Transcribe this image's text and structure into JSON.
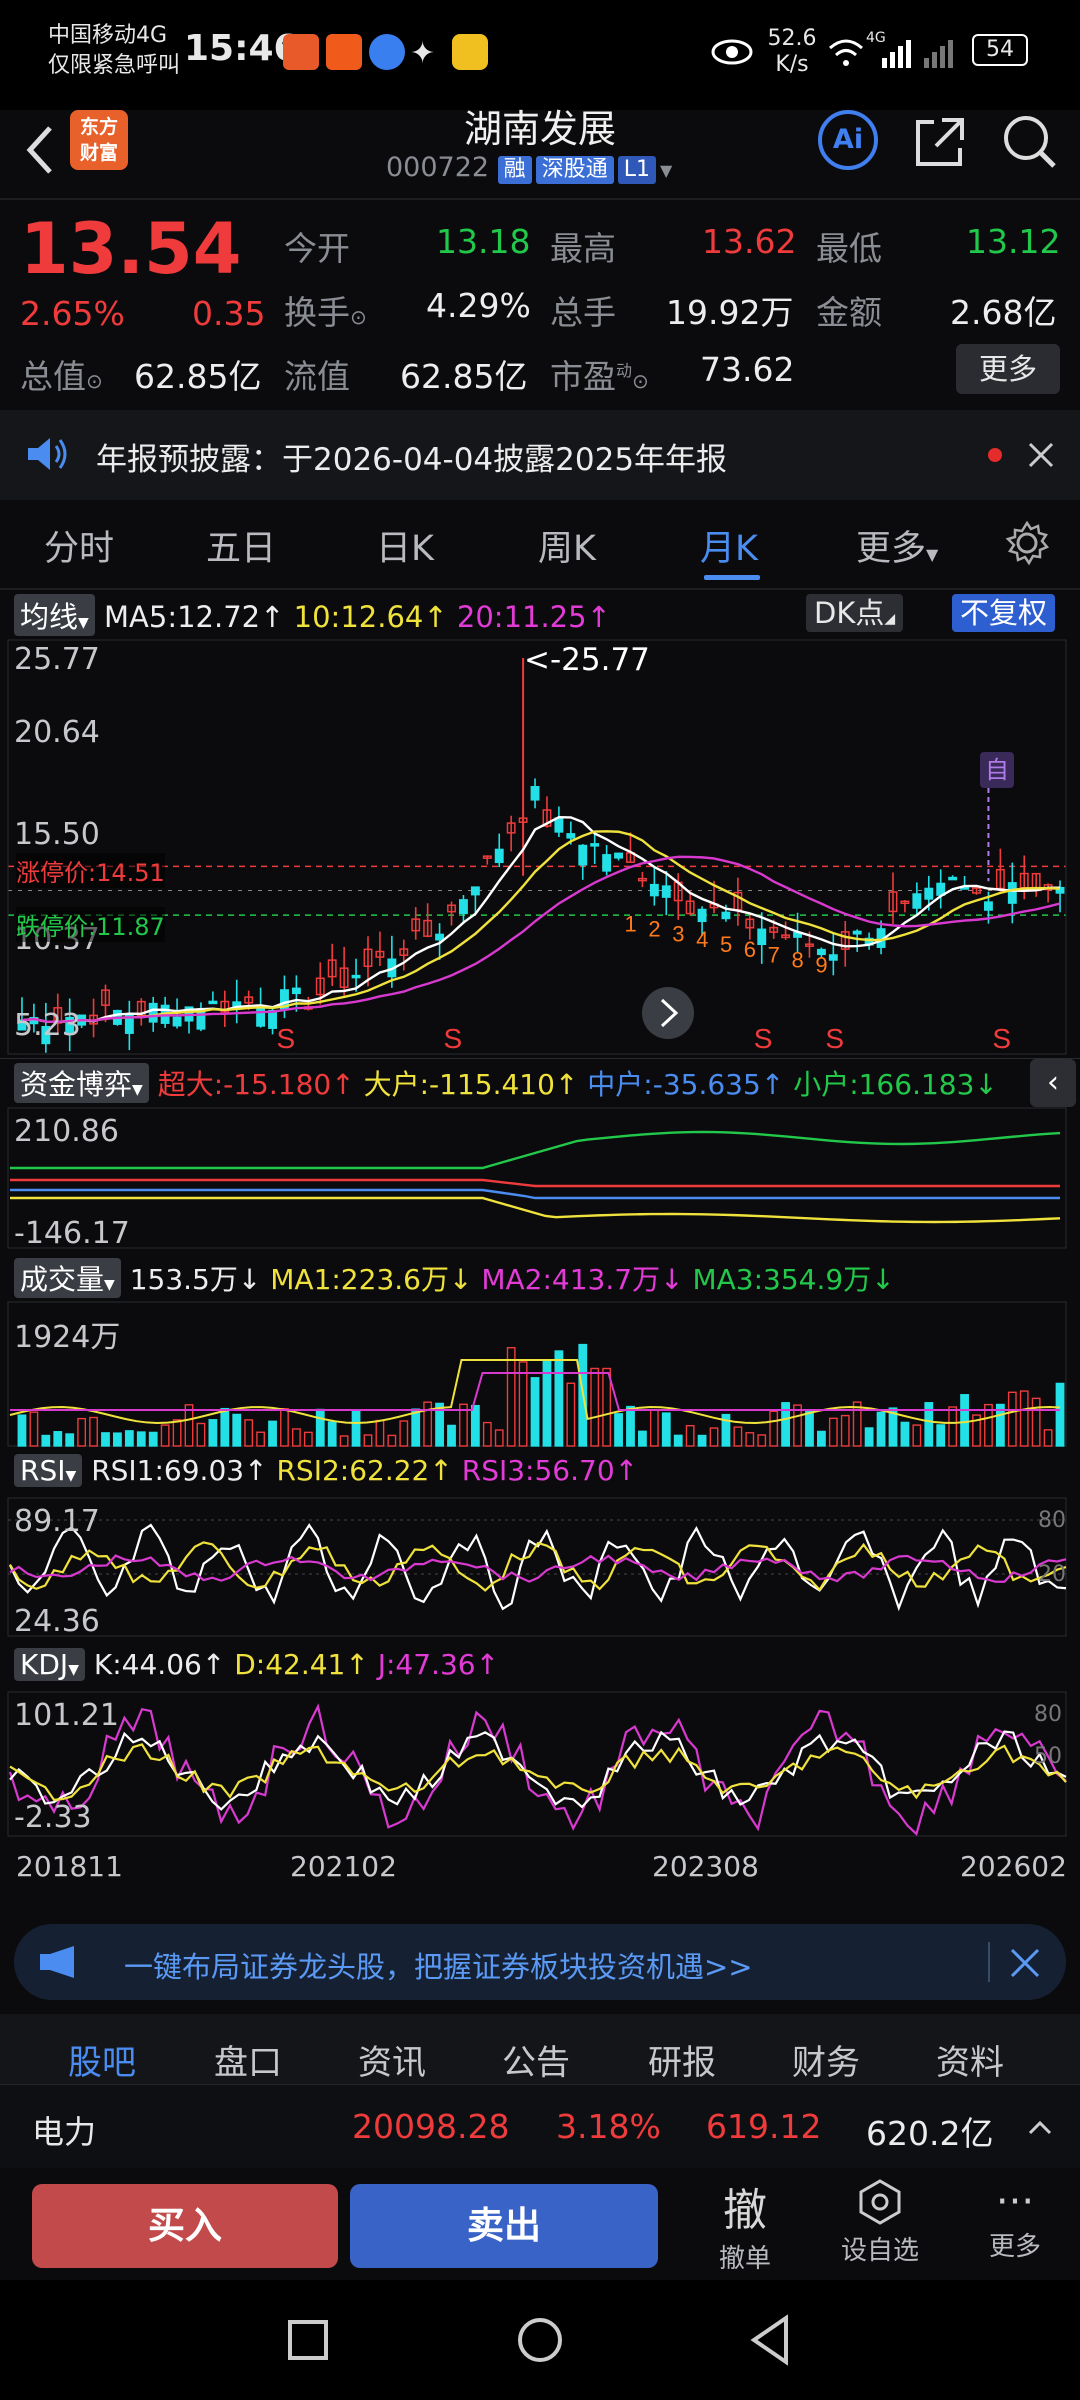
{
  "status_bar": {
    "carrier": "中国移动4G",
    "carrier_sub": "仅限紧急呼叫",
    "time": "15:46",
    "speed": "52.6",
    "speed_unit": "K/s",
    "net1": "4G",
    "battery": "54"
  },
  "header": {
    "stock_name": "湖南发展",
    "code": "000722",
    "tags": [
      "融",
      "深股通",
      "L1"
    ],
    "logo_line1": "东方",
    "logo_line2": "财富",
    "ai_label": "Ai"
  },
  "quote": {
    "price": "13.54",
    "change_pct": "2.65%",
    "change": "0.35",
    "open_label": "今开",
    "open": "13.18",
    "high_label": "最高",
    "high": "13.62",
    "low_label": "最低",
    "low": "13.12",
    "turnover_label": "换手",
    "turnover": "4.29%",
    "volume_label": "总手",
    "volume": "19.92万",
    "amount_label": "金额",
    "amount": "2.68亿",
    "mktcap_label": "总值",
    "mktcap": "62.85亿",
    "float_label": "流值",
    "float": "62.85亿",
    "pe_label": "市盈",
    "pe_sup": "动",
    "pe": "73.62",
    "more": "更多"
  },
  "notice": {
    "text": "年报预披露：于2026-04-04披露2025年年报"
  },
  "tabs": [
    "分时",
    "五日",
    "日K",
    "周K",
    "月K",
    "更多"
  ],
  "active_tab": "月K",
  "ma_bar": {
    "label": "均线",
    "ma5": "MA5:12.72",
    "ma10": "10:12.64",
    "ma20": "20:11.25",
    "dk": "DK点",
    "fq": "不复权"
  },
  "kline": {
    "price_labels": [
      "25.77",
      "20.64",
      "15.50",
      "10.37",
      "5.23"
    ],
    "peak": "<-25.77",
    "limit_up": "涨停价:14.51",
    "limit_down": "跌停价:11.87",
    "marker_zi": "自",
    "seq_nums": [
      "1",
      "2",
      "3",
      "4",
      "5",
      "6",
      "7",
      "8",
      "9"
    ],
    "s_marks": [
      "S",
      "S",
      "S",
      "S",
      "S"
    ]
  },
  "fund": {
    "label": "资金博弈",
    "super": "超大:-15.180",
    "big": "大户:-115.410",
    "mid": "中户:-35.635",
    "small": "小户:166.183",
    "max": "210.86",
    "min": "-146.17"
  },
  "vol": {
    "label": "成交量",
    "val": "153.5万",
    "ma1": "MA1:223.6万",
    "ma2": "MA2:413.7万",
    "ma3": "MA3:354.9万",
    "max": "1924万"
  },
  "rsi": {
    "label": "RSI",
    "rsi1": "RSI1:69.03",
    "rsi2": "RSI2:62.22",
    "rsi3": "RSI3:56.70",
    "max": "89.17",
    "min": "24.36",
    "l80": "80",
    "l20": "20"
  },
  "kdj": {
    "label": "KDJ",
    "k": "K:44.06",
    "d": "D:42.41",
    "j": "J:47.36",
    "max": "101.21",
    "min": "-2.33",
    "l80": "80",
    "l50": "50"
  },
  "xaxis": [
    "201811",
    "202102",
    "202308",
    "202602"
  ],
  "ad": {
    "text": "一键布局证券龙头股，把握证券板块投资机遇>>"
  },
  "bottom_tabs": [
    "股吧",
    "盘口",
    "资讯",
    "公告",
    "研报",
    "财务",
    "资料"
  ],
  "sector": {
    "name": "电力",
    "price": "20098.28",
    "pct": "3.18%",
    "change": "619.12",
    "amount": "620.2亿"
  },
  "actions": {
    "buy": "买入",
    "sell": "卖出",
    "cancel_icon": "撤",
    "cancel": "撤单",
    "watch": "设自选",
    "more": "更多"
  },
  "colors": {
    "red": "#ef3b3b",
    "green": "#22c84a",
    "blue_btn": "#3a63c8",
    "buy_btn": "#c44444",
    "accent": "#4a8cf0"
  },
  "chart_data": {
    "type": "candlestick",
    "period": "monthly",
    "x_ticks": [
      "201811",
      "202102",
      "202308",
      "202602"
    ],
    "ylim": [
      5.23,
      25.77
    ],
    "peak_high": 25.77,
    "series": [
      {
        "name": "MA5",
        "last": 12.72
      },
      {
        "name": "MA10",
        "last": 12.64
      },
      {
        "name": "MA20",
        "last": 11.25
      }
    ]
  }
}
